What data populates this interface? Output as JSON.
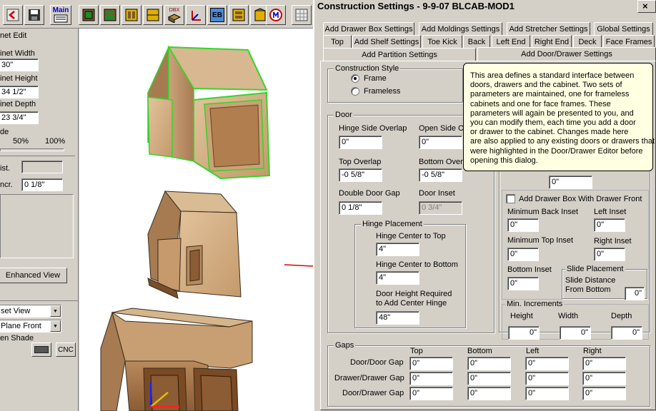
{
  "toolbar": {
    "main_label": "Main",
    "dbx_label": "DBX",
    "eb_label": "EB",
    "icons": [
      "back-icon",
      "save-icon",
      "settings-icon",
      "main-icon",
      "cabinet-icon",
      "cabinet-icon",
      "cabinet-icon",
      "cabinet-icon",
      "dbx-icon",
      "axis-icon",
      "eb-icon",
      "cabinet-icon",
      "cabinet-icon",
      "cm-icon",
      "grid-icon"
    ]
  },
  "left_panel": {
    "edit_label": "net Edit",
    "width_label": "inet Width",
    "width_value": "30\"",
    "height_label": "inet Height",
    "height_value": "34 1/2\"",
    "depth_label": "inet Depth",
    "depth_value": "23 3/4\"",
    "shade_label": "de",
    "scale_50": "50%",
    "scale_100": "100%",
    "dist_label": "ist.",
    "incr_label": "ncr.",
    "incr_value": "0 1/8\"",
    "enhanced_view_label": "Enhanced View",
    "view_combo": "set View",
    "plane_combo": "Plane Front",
    "hidden_shade_label": "en Shade",
    "cnc_label": "CNC"
  },
  "dialog": {
    "title": "Construction Settings - 9-9-07 BLCAB-MOD1",
    "tabs_row1": [
      "Add Drawer Box Settings",
      "Add Moldings Settings",
      "Add Stretcher Settings",
      "Global Settings"
    ],
    "tabs_row2": [
      "Top",
      "Add Shelf Settings",
      "Toe Kick",
      "Back",
      "Left End",
      "Right End",
      "Deck",
      "Face Frames"
    ],
    "tabs_row3": [
      "Add Partition Settings",
      "Add Door/Drawer Settings"
    ],
    "construction_style": {
      "title": "Construction Style",
      "frame": "Frame",
      "frameless": "Frameless"
    },
    "door": {
      "title": "Door",
      "hinge_side_overlap": "Hinge Side Overlap",
      "hinge_side_overlap_value": "0\"",
      "open_side_overlap": "Open Side O",
      "open_side_overlap_value": "0\"",
      "top_overlap": "Top Overlap",
      "top_overlap_value": "-0 5/8\"",
      "bottom_overlap": "Bottom Overl",
      "bottom_overlap_value": "-0 5/8\"",
      "double_door_gap": "Double Door Gap",
      "double_door_gap_value": "0 1/8\"",
      "door_inset": "Door Inset",
      "door_inset_value": "0 3/4\""
    },
    "hinge_placement": {
      "title": "Hinge Placement",
      "center_to_top": "Hinge Center to Top",
      "center_to_top_value": "4\"",
      "center_to_bottom": "Hinge Center to Bottom",
      "center_to_bottom_value": "4\"",
      "door_height_line1": "Door Height Required",
      "door_height_line2": "to Add Center Hinge",
      "door_height_value": "48\""
    },
    "drawer_front": {
      "hidden_value": "0\"",
      "add_box_label": "Add Drawer Box With Drawer Front",
      "min_back_inset": "Minimum Back Inset",
      "min_back_inset_value": "0\"",
      "left_inset": "Left Inset",
      "left_inset_value": "0\"",
      "min_top_inset": "Minimum Top Inset",
      "min_top_inset_value": "0\"",
      "right_inset": "Right Inset",
      "right_inset_value": "0\"",
      "bottom_inset": "Bottom Inset",
      "bottom_inset_value": "0\"",
      "slide_placement": "Slide Placement",
      "slide_distance_line1": "Slide Distance",
      "slide_distance_line2": "From Bottom",
      "slide_distance_value": "0\""
    },
    "min_increments": {
      "title": "Min. Increments",
      "height": "Height",
      "height_value": "0\"",
      "width": "Width",
      "width_value": "0\"",
      "depth": "Depth",
      "depth_value": "0\""
    },
    "gaps": {
      "title": "Gaps",
      "columns": [
        "Top",
        "Bottom",
        "Left",
        "Right"
      ],
      "rows": [
        {
          "label": "Door/Door Gap",
          "values": [
            "0\"",
            "0\"",
            "0\"",
            "0\""
          ]
        },
        {
          "label": "Drawer/Drawer Gap",
          "values": [
            "0\"",
            "0\"",
            "0\"",
            "0\""
          ]
        },
        {
          "label": "Door/Drawer Gap",
          "values": [
            "0\"",
            "0\"",
            "0\"",
            "0\""
          ]
        }
      ]
    },
    "tooltip": [
      "This area defines a standard interface between",
      "doors, drawers and the cabinet. Two sets of",
      "parameters are maintained, one for frameless",
      "cabinets and one for face frames. These",
      "parameters will again be presented to you, and",
      "you can modify them, each time you add a door",
      "or drawer to the cabinet. Changes made here",
      "are also applied to any existing doors or drawers that",
      "were highlighted in the Door/Drawer Editor before",
      "opening this dialog."
    ]
  }
}
